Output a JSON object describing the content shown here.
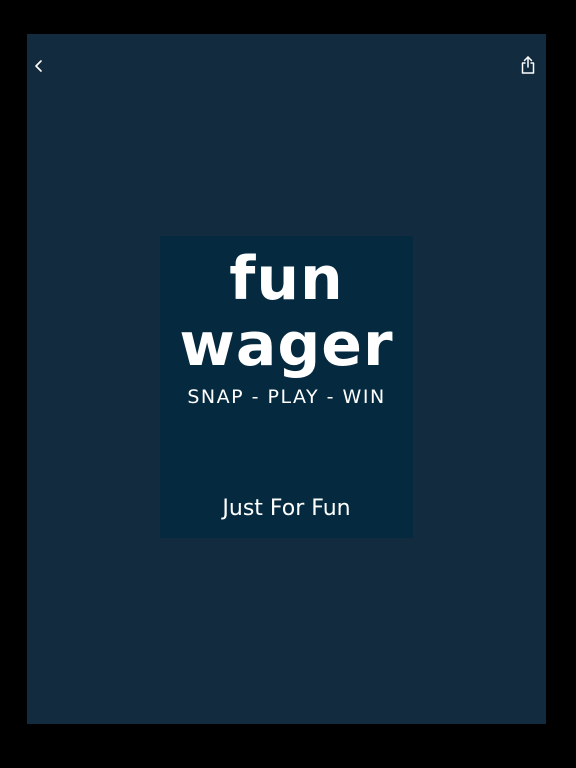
{
  "nav": {
    "back_icon": "chevron-left-icon",
    "share_icon": "share-icon"
  },
  "splash": {
    "logo_line_1": "fun",
    "logo_line_2": "wager",
    "tagline": "SNAP - PLAY - WIN",
    "subtitle": "Just For Fun"
  },
  "colors": {
    "page_background": "#000000",
    "screen_background": "#122b3e",
    "splash_background": "#052a40",
    "text": "#ffffff",
    "icon": "#ffffff"
  }
}
